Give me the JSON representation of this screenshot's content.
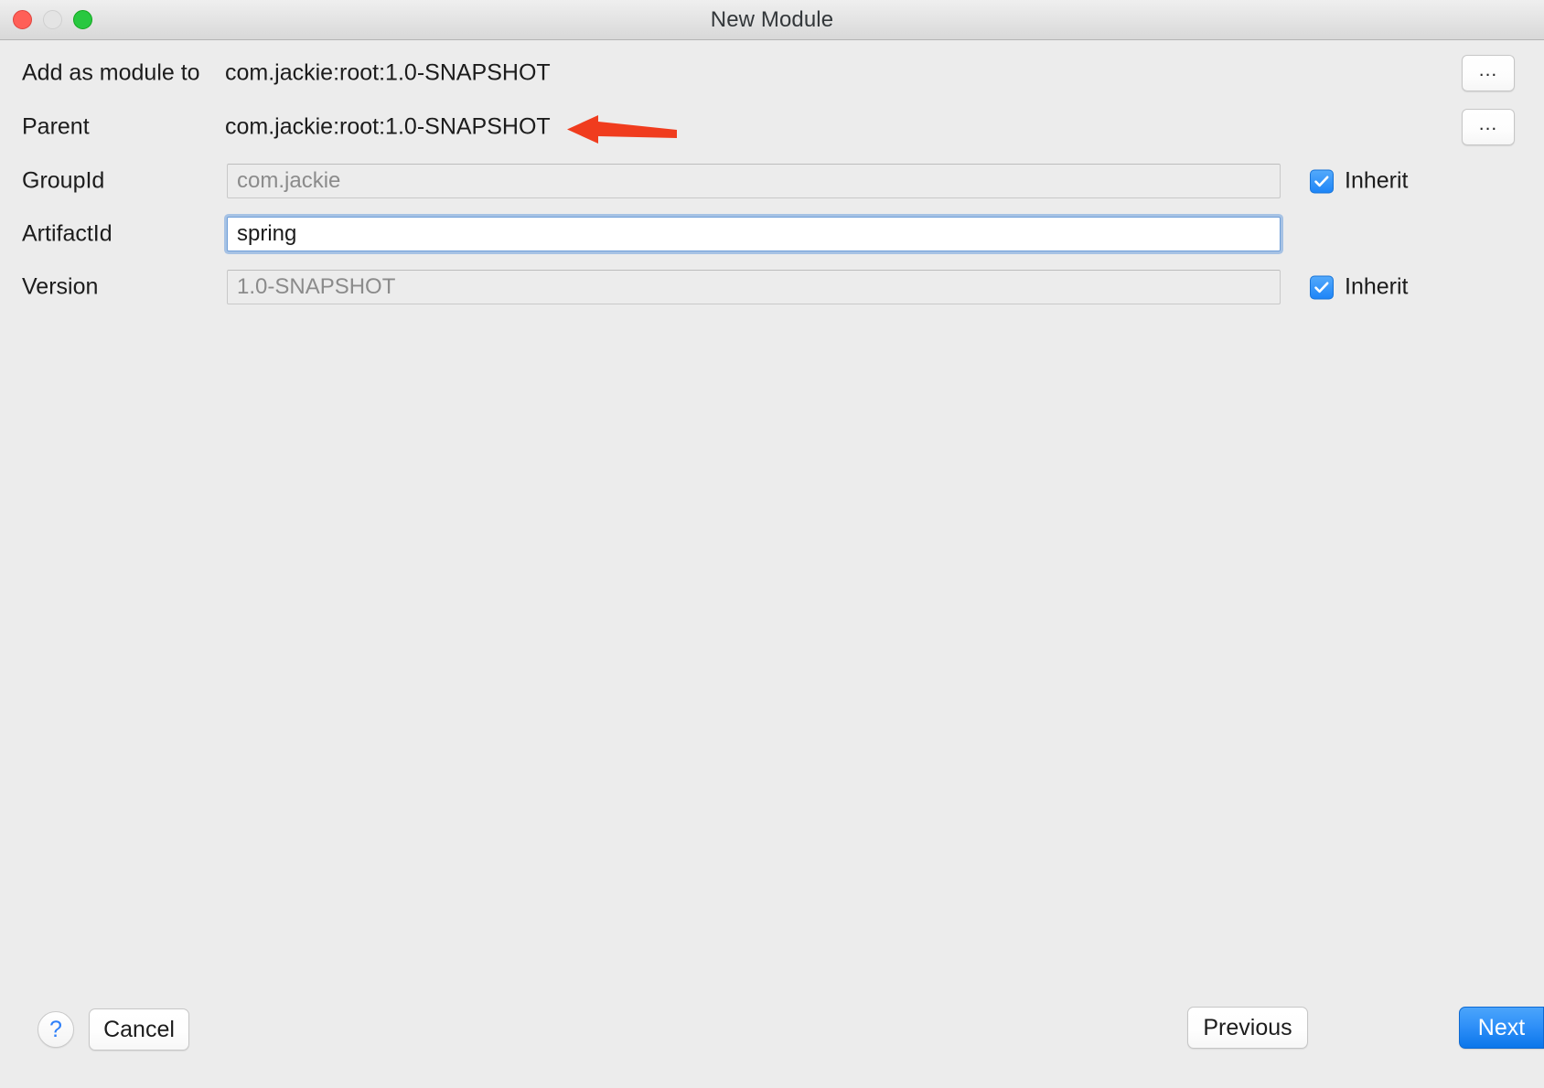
{
  "window": {
    "title": "New Module",
    "traffic_lights": [
      "close-button",
      "minimize-button",
      "maximize-button"
    ]
  },
  "form": {
    "rows": [
      {
        "label": "Add as module to",
        "type": "static",
        "value": "com.jackie:root:1.0-SNAPSHOT",
        "has_browse_button": true,
        "browse_label": "...",
        "has_inherit": false
      },
      {
        "label": "Parent",
        "type": "static",
        "value": "com.jackie:root:1.0-SNAPSHOT",
        "has_browse_button": true,
        "browse_label": "...",
        "has_inherit": false,
        "annotated": true
      },
      {
        "label": "GroupId",
        "type": "field",
        "value": "com.jackie",
        "state": "disabled",
        "has_browse_button": false,
        "has_inherit": true,
        "inherit_label": "Inherit",
        "inherit_checked": true
      },
      {
        "label": "ArtifactId",
        "type": "field",
        "value": "spring",
        "state": "focused",
        "has_browse_button": false,
        "has_inherit": false
      },
      {
        "label": "Version",
        "type": "field",
        "value": "1.0-SNAPSHOT",
        "state": "disabled",
        "has_browse_button": false,
        "has_inherit": true,
        "inherit_label": "Inherit",
        "inherit_checked": true
      }
    ]
  },
  "annotation": {
    "type": "arrow",
    "direction": "left",
    "color": "#f03c1e",
    "points_at": "Parent value"
  },
  "footer": {
    "help_label": "?",
    "cancel_label": "Cancel",
    "previous_label": "Previous",
    "next_label": "Next"
  },
  "colors": {
    "window_background": "#ececec",
    "accent_blue": "#2e8ff8",
    "checkbox_blue": "#1e85f7",
    "annotation_red": "#f03c1e",
    "close_red": "#ff5f57",
    "maximize_green": "#28c840"
  }
}
